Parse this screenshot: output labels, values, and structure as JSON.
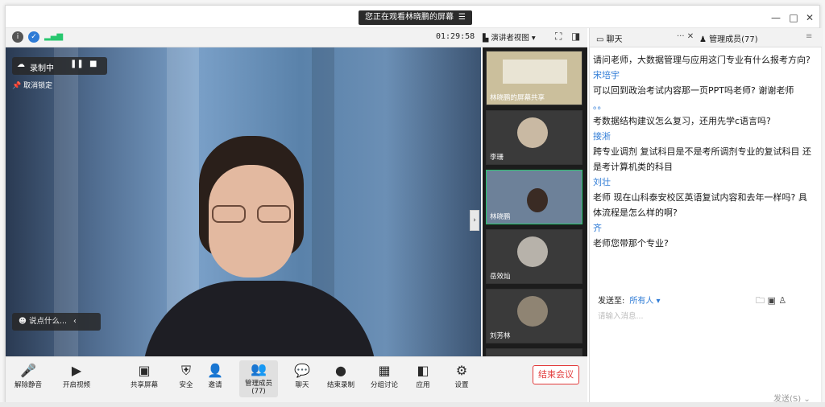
{
  "window": {
    "viewing_label": "您正在观看林晓鹏的屏幕",
    "minimize": "—",
    "maximize": "□",
    "close": "✕"
  },
  "topbar": {
    "timer": "01:29:58",
    "speaker_view": "演讲者视图 ▾"
  },
  "video": {
    "recording_label": "录制中",
    "unpin_label": "取消锁定",
    "say_placeholder": "说点什么...",
    "participants": [
      {
        "name": "林晓鹏的屏幕共享",
        "active": false
      },
      {
        "name": "李珊",
        "active": false
      },
      {
        "name": "林晓鹏",
        "active": true
      },
      {
        "name": "岳效灿",
        "active": false
      },
      {
        "name": "刘芳林",
        "active": false
      }
    ]
  },
  "toolbar": {
    "items": [
      {
        "label": "解除静音",
        "icon": "mic-muted-icon",
        "glyph": "🎤"
      },
      {
        "label": "开启视频",
        "icon": "video-off-icon",
        "glyph": "▶"
      },
      {
        "label": "共享屏幕",
        "icon": "share-screen-icon",
        "glyph": "▣"
      },
      {
        "label": "安全",
        "icon": "shield-icon",
        "glyph": "⛨"
      },
      {
        "label": "邀请",
        "icon": "invite-icon",
        "glyph": "👤"
      },
      {
        "label": "管理成员(77)",
        "icon": "members-icon",
        "glyph": "👥"
      },
      {
        "label": "聊天",
        "icon": "chat-icon",
        "glyph": "💬"
      },
      {
        "label": "结束录制",
        "icon": "stop-record-icon",
        "glyph": "●"
      },
      {
        "label": "分组讨论",
        "icon": "breakout-icon",
        "glyph": "▦"
      },
      {
        "label": "应用",
        "icon": "apps-icon",
        "glyph": "◧"
      },
      {
        "label": "设置",
        "icon": "gear-icon",
        "glyph": "⚙"
      }
    ],
    "end_meeting": "结束会议"
  },
  "chat": {
    "tab_chat": "聊天",
    "tab_members": "管理成员(77)",
    "messages": [
      {
        "sender": "",
        "text": "请问老师，大数据管理与应用这门专业有什么报考方向?"
      },
      {
        "sender": "宋培宇",
        "text": "可以回到政治考试内容那一页PPT吗老师? 谢谢老师"
      },
      {
        "sender": "。。",
        "text": "考数据结构建议怎么复习，还用先学c语言吗?"
      },
      {
        "sender": "接淅",
        "text": "跨专业调剂 复试科目是不是考所调剂专业的复试科目 还是考计算机类的科目"
      },
      {
        "sender": "刘壮",
        "text": "老师 现在山科泰安校区英语复试内容和去年一样吗? 具体流程是怎么样的啊?"
      },
      {
        "sender": "齐",
        "text": "老师您带那个专业?"
      }
    ],
    "send_to_label": "发送至:",
    "send_to_value": "所有人 ▾",
    "input_placeholder": "请输入消息...",
    "send_button": "发送(S)"
  }
}
